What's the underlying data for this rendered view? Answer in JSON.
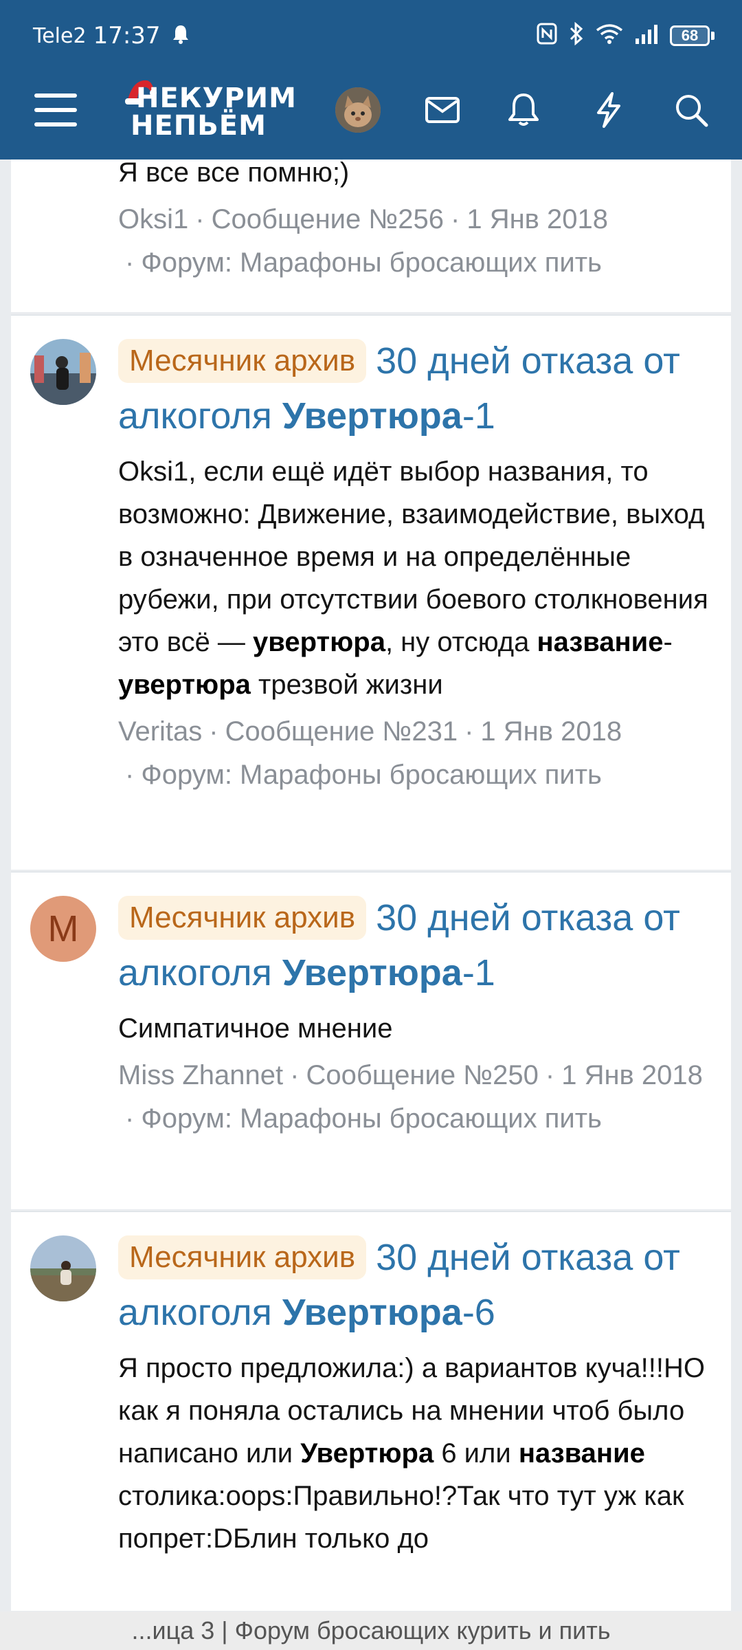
{
  "status_bar": {
    "carrier": "Tele2",
    "time": "17:37",
    "battery": "68"
  },
  "navbar": {
    "logo_line1": "НЕКУРИМ",
    "logo_line2": "НЕПЬЁМ"
  },
  "results": [
    {
      "snippet_end": "Я все все помню;)",
      "author": "Oksi1",
      "post": "Сообщение №256",
      "date": "1 Янв 2018",
      "forum": "Форум: Марафоны бросающих пить"
    },
    {
      "badge": "Месячник архив",
      "title_pre": "30 дней отказа от алкоголя ",
      "title_hl": "Увертюра",
      "title_post": "-1",
      "snippet_1": "Oksi1, если ещё идёт выбор названия, то возможно: Движение, взаимодействие, выход в означенное время и на определённые рубежи, при отсутствии боевого столкновения это всё — ",
      "snippet_b1": "увертюра",
      "snippet_2": ", ну отсюда ",
      "snippet_b2": "название",
      "snippet_3": "-",
      "snippet_b3": "увертюра",
      "snippet_4": " трезвой жизни",
      "author": "Veritas",
      "post": "Сообщение №231",
      "date": "1 Янв 2018",
      "forum": "Форум: Марафоны бросающих пить"
    },
    {
      "badge": "Месячник архив",
      "title_pre": "30 дней отказа от алкоголя ",
      "title_hl": "Увертюра",
      "title_post": "-1",
      "avatar_letter": "M",
      "snippet": "Симпатичное мнение",
      "author": "Miss Zhannet",
      "post": "Сообщение №250",
      "date": "1 Янв 2018",
      "forum": "Форум: Марафоны бросающих пить"
    },
    {
      "badge": "Месячник архив",
      "title_pre": "30 дней отказа от алкоголя ",
      "title_hl": "Увертюра",
      "title_post": "-6",
      "snippet_1": "Я просто предложила:) а вариантов куча!!!НО как я поняла остались на мнении чтоб было написано или ",
      "snippet_b1": "Увертюра",
      "snippet_2": " 6 или ",
      "snippet_b2": "название",
      "snippet_3": " столика:oops:Правильно!?Так что тут уж как попрет:DБлин только до"
    }
  ],
  "footer": {
    "page_title": "...ица 3 | Форум бросающих курить и пить"
  },
  "colors": {
    "header_bg": "#1f5a8c",
    "link": "#2d74aa",
    "badge_bg": "#fdf2e0",
    "badge_text": "#b9671a",
    "meta": "#8a8f96"
  }
}
